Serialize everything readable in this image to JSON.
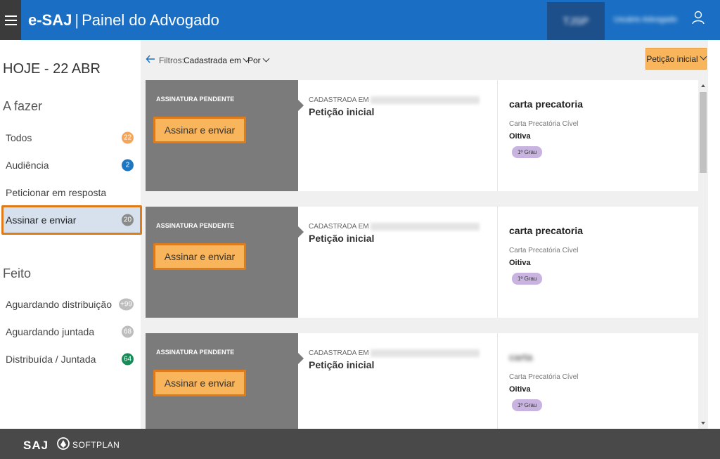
{
  "header": {
    "brand": "e-SAJ",
    "separator": "|",
    "subtitle": "Painel do Advogado",
    "org_badge": "TJSP",
    "user_name": "Usuário Advogado"
  },
  "sidebar": {
    "date": "HOJE - 22 ABR",
    "todo_title": "A fazer",
    "todo_items": [
      {
        "label": "Todos",
        "count": "22",
        "color": "#f5a55a"
      },
      {
        "label": "Audiência",
        "count": "2",
        "color": "#1f77c2"
      },
      {
        "label": "Peticionar em resposta",
        "count": "",
        "color": ""
      },
      {
        "label": "Assinar e enviar",
        "count": "20",
        "color": "#8a8a8a"
      }
    ],
    "done_title": "Feito",
    "done_items": [
      {
        "label": "Aguardando distribuição",
        "count": "+99",
        "color": "#bdbdbd"
      },
      {
        "label": "Aguardando juntada",
        "count": "68",
        "color": "#bdbdbd"
      },
      {
        "label": "Distribuída / Juntada",
        "count": "64",
        "color": "#178a57"
      }
    ]
  },
  "toolbar": {
    "filters_label": "Filtros:",
    "filter_registered": "Cadastrada em",
    "filter_by": "Por",
    "type_filter": "Petição inicial"
  },
  "cards": [
    {
      "status": "ASSINATURA PENDENTE",
      "action": "Assinar e enviar",
      "registered_label": "CADASTRADA EM",
      "petition_type": "Petição inicial",
      "class_name": "carta precatoria",
      "class_blurred": false,
      "sub_class": "Carta Precatória Cível",
      "subject": "Oitiva",
      "degree": "1º Grau"
    },
    {
      "status": "ASSINATURA PENDENTE",
      "action": "Assinar e enviar",
      "registered_label": "CADASTRADA EM",
      "petition_type": "Petição inicial",
      "class_name": "carta precatoria",
      "class_blurred": false,
      "sub_class": "Carta Precatória Cível",
      "subject": "Oitiva",
      "degree": "1º Grau"
    },
    {
      "status": "ASSINATURA PENDENTE",
      "action": "Assinar e enviar",
      "registered_label": "CADASTRADA EM",
      "petition_type": "Petição inicial",
      "class_name": "carta",
      "class_blurred": true,
      "sub_class": "Carta Precatória Cível",
      "subject": "Oitiva",
      "degree": "1º Grau"
    }
  ],
  "footer": {
    "saj": "SAJ",
    "softplan": "SOFTPLAN"
  }
}
